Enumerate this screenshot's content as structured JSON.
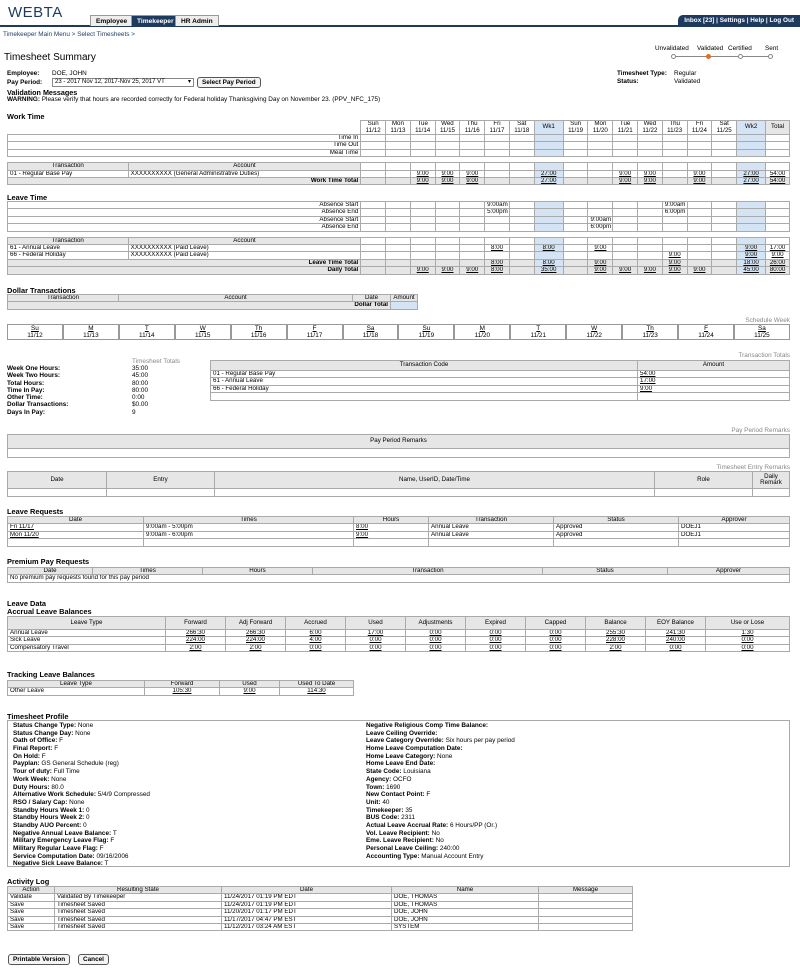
{
  "app": {
    "logo": "WEBTA",
    "tabs": [
      "Employee",
      "Timekeeper",
      "HR Admin"
    ],
    "active_tab": "Timekeeper",
    "inbox": "Inbox [23]",
    "settings": "Settings",
    "help": "Help",
    "logout": "Log Out",
    "sep": " | "
  },
  "breadcrumb": {
    "main": "Timekeeper Main Menu",
    "sep": " > ",
    "current": "Select Timesheets",
    "end": " >"
  },
  "page": {
    "title": "Timesheet Summary"
  },
  "progress": {
    "steps": [
      "Unvalidated",
      "Validated",
      "Certified",
      "Sent"
    ],
    "current": 1,
    "accent": "#e07020"
  },
  "header": {
    "employee_label": "Employee:",
    "employee": "DOE, JOHN",
    "period_label": "Pay Period:",
    "period": "23 - 2017  Nov 12, 2017-Nov 25, 2017 VT",
    "select_btn": "Select Pay Period",
    "type_label": "Timesheet Type:",
    "type": "Regular",
    "status_label": "Status:",
    "status": "Validated"
  },
  "validation": {
    "title": "Validation Messages",
    "warning_label": "WARNING:",
    "warning": " Please verify that hours are recorded correctly for Federal holiday Thanksgiving Day on November 23. (PPV_NFC_175)"
  },
  "days": [
    {
      "d": "Sun",
      "n": "11/12"
    },
    {
      "d": "Mon",
      "n": "11/13"
    },
    {
      "d": "Tue",
      "n": "11/14"
    },
    {
      "d": "Wed",
      "n": "11/15"
    },
    {
      "d": "Thu",
      "n": "11/16"
    },
    {
      "d": "Fri",
      "n": "11/17"
    },
    {
      "d": "Sat",
      "n": "11/18"
    },
    {
      "d": "Sun",
      "n": "11/19"
    },
    {
      "d": "Mon",
      "n": "11/20"
    },
    {
      "d": "Tue",
      "n": "11/21"
    },
    {
      "d": "Wed",
      "n": "11/22"
    },
    {
      "d": "Thu",
      "n": "11/23"
    },
    {
      "d": "Fri",
      "n": "11/24"
    },
    {
      "d": "Sat",
      "n": "11/25"
    }
  ],
  "wk1": "Wk1",
  "wk2": "Wk2",
  "total_label": "Total",
  "work_time": {
    "title": "Work Time",
    "rows": [
      "Time In",
      "Time Out",
      "Meal Time"
    ],
    "tx_header": "Transaction",
    "acct_header": "Account",
    "lines": [
      {
        "tx": "01 - Regular Base Pay",
        "acct": "XXXXXXXXXX (General Administrative Duties)",
        "v": [
          "",
          "",
          "9:00",
          "9:00",
          "9:00",
          "",
          "",
          "27:00",
          "",
          "",
          "9:00",
          "9:00",
          "",
          "9:00",
          "",
          "27:00",
          "54:00"
        ]
      }
    ],
    "total_label": "Work Time Total",
    "total": [
      "",
      "",
      "9:00",
      "9:00",
      "9:00",
      "",
      "",
      "27:00",
      "",
      "",
      "9:00",
      "9:00",
      "",
      "9:00",
      "",
      "27:00",
      "54:00"
    ]
  },
  "leave_time": {
    "title": "Leave Time",
    "rows": [
      "Absence Start",
      "Absence End",
      "Absence Start",
      "Absence End"
    ],
    "abs": [
      [
        "",
        "",
        "",
        "",
        "",
        "9:00am",
        "",
        "",
        "",
        "",
        "",
        "",
        "9:00am",
        "",
        "",
        "",
        ""
      ],
      [
        "",
        "",
        "",
        "",
        "",
        "5:00pm",
        "",
        "",
        "",
        "",
        "",
        "",
        "6:00pm",
        "",
        "",
        "",
        ""
      ],
      [
        "",
        "",
        "",
        "",
        "",
        "",
        "",
        "",
        "",
        "9:00am",
        "",
        "",
        "",
        "",
        "",
        "",
        ""
      ],
      [
        "",
        "",
        "",
        "",
        "",
        "",
        "",
        "",
        "",
        "6:00pm",
        "",
        "",
        "",
        "",
        "",
        "",
        ""
      ]
    ],
    "lines": [
      {
        "tx": "61 - Annual Leave",
        "acct": "XXXXXXXXXX (Paid Leave)",
        "v": [
          "",
          "",
          "",
          "",
          "",
          "8:00",
          "",
          "8:00",
          "",
          "9:00",
          "",
          "",
          "",
          "",
          "",
          "9:00",
          "17:00"
        ]
      },
      {
        "tx": "66 - Federal Holiday",
        "acct": "XXXXXXXXXX (Paid Leave)",
        "v": [
          "",
          "",
          "",
          "",
          "",
          "",
          "",
          "",
          "",
          "",
          "",
          "",
          "9:00",
          "",
          "",
          "9:00",
          "9:00"
        ]
      }
    ],
    "total_label": "Leave Time Total",
    "total": [
      "",
      "",
      "",
      "",
      "",
      "8:00",
      "",
      "8:00",
      "",
      "9:00",
      "",
      "",
      "9:00",
      "",
      "",
      "18:00",
      "26:00"
    ],
    "daily_label": "Daily Total",
    "daily": [
      "",
      "",
      "9:00",
      "9:00",
      "9:00",
      "8:00",
      "",
      "35:00",
      "",
      "9:00",
      "9:00",
      "9:00",
      "9:00",
      "9:00",
      "",
      "45:00",
      "80:00"
    ]
  },
  "dollar": {
    "title": "Dollar Transactions",
    "headers": [
      "Transaction",
      "Account",
      "Date",
      "Amount"
    ],
    "total_label": "Dollar Total"
  },
  "schedule": {
    "label": "Schedule Week",
    "days": [
      "Su",
      "M",
      "T",
      "W",
      "Th",
      "F",
      "Sa",
      "Su",
      "M",
      "T",
      "W",
      "Th",
      "F",
      "Sa"
    ]
  },
  "totals": {
    "label": "Timesheet Totals",
    "rows": [
      [
        "Week One Hours:",
        "35:00"
      ],
      [
        "Week Two Hours:",
        "45:00"
      ],
      [
        "Total Hours:",
        "80:00"
      ],
      [
        "Time In Pay:",
        "80:00"
      ],
      [
        "Other Time:",
        "0:00"
      ],
      [
        "Dollar Transactions:",
        "$0.00"
      ],
      [
        "Days In Pay:",
        "9"
      ]
    ]
  },
  "tx_totals": {
    "label": "Transaction Totals",
    "headers": [
      "Transaction Code",
      "Amount"
    ],
    "rows": [
      [
        "01 - Regular Base Pay",
        "54:00"
      ],
      [
        "61 - Annual Leave",
        "17:00"
      ],
      [
        "66 - Federal Holiday",
        "9:00"
      ]
    ]
  },
  "remarks": {
    "label": "Pay Period Remarks",
    "header": "Pay Period Remarks"
  },
  "entry_remarks": {
    "label": "Timesheet Entry Remarks",
    "headers": [
      "Date",
      "Entry",
      "Name, UserID, Date/Time",
      "Role",
      "Daily Remark"
    ]
  },
  "leave_requests": {
    "title": "Leave Requests",
    "headers": [
      "Date",
      "Times",
      "Hours",
      "Transaction",
      "Status",
      "Approver"
    ],
    "rows": [
      [
        "Fri 11/17",
        "9:00am - 5:00pm",
        "8:00",
        "Annual Leave",
        "Approved",
        "DOEJ1"
      ],
      [
        "Mon 11/20",
        "9:00am - 6:00pm",
        "9:00",
        "Annual Leave",
        "Approved",
        "DOEJ1"
      ]
    ]
  },
  "premium": {
    "title": "Premium Pay Requests",
    "headers": [
      "Date",
      "Times",
      "Hours",
      "Transaction",
      "Status",
      "Approver"
    ],
    "empty": "No premium pay requests found for this pay period"
  },
  "leave_data": {
    "title": "Leave Data",
    "accrual_title": "Accrual Leave Balances",
    "headers": [
      "Leave Type",
      "Forward",
      "Adj Forward",
      "Accrued",
      "Used",
      "Adjustments",
      "Expired",
      "Capped",
      "Balance",
      "EOY Balance",
      "Use or Lose"
    ],
    "rows": [
      [
        "Annual Leave",
        "266:30",
        "266:30",
        "6:00",
        "17:00",
        "0:00",
        "0:00",
        "0:00",
        "255:30",
        "241:30",
        "1:30"
      ],
      [
        "Sick Leave",
        "224:00",
        "224:00",
        "4:00",
        "0:00",
        "0:00",
        "0:00",
        "0:00",
        "228:00",
        "240:00",
        "0:00"
      ],
      [
        "Compensatory Travel",
        "2:00",
        "2:00",
        "0:00",
        "0:00",
        "0:00",
        "0:00",
        "0:00",
        "2:00",
        "0:00",
        "0:00"
      ]
    ]
  },
  "tracking": {
    "title": "Tracking Leave Balances",
    "headers": [
      "Leave Type",
      "Forward",
      "Used",
      "Used To Date"
    ],
    "rows": [
      [
        "Other Leave",
        "105:30",
        "9:00",
        "114:30"
      ]
    ]
  },
  "profile": {
    "title": "Timesheet Profile",
    "left": [
      [
        "Status Change Type:",
        "None"
      ],
      [
        "Status Change Day:",
        "None"
      ],
      [
        "Oath of Office:",
        "F"
      ],
      [
        "Final Report:",
        "F"
      ],
      [
        "On Hold:",
        "F"
      ],
      [
        "Payplan:",
        "GS General Schedule (reg)"
      ],
      [
        "Tour of duty:",
        "Full Time"
      ],
      [
        "Work Week:",
        "None"
      ],
      [
        "Duty Hours:",
        "80.0"
      ],
      [
        "Alternative Work Schedule:",
        "5/4/9 Compressed"
      ],
      [
        "RSO / Salary Cap:",
        "None"
      ],
      [
        "Standby Hours Week 1:",
        "0"
      ],
      [
        "Standby Hours Week 2:",
        "0"
      ],
      [
        "Standby AUO Percent:",
        "0"
      ],
      [
        "Negative Annual Leave Balance:",
        "T"
      ],
      [
        "Military Emergency Leave Flag:",
        "F"
      ],
      [
        "Military Regular Leave Flag:",
        "F"
      ],
      [
        "Service Computation Date:",
        "09/16/2006"
      ],
      [
        "Negative Sick Leave Balance:",
        "T"
      ]
    ],
    "right": [
      [
        "Negative Religious Comp Time Balance:",
        ""
      ],
      [
        "Leave Ceiling Override:",
        ""
      ],
      [
        "Leave Category Override:",
        "Six hours per pay period"
      ],
      [
        "Home Leave Computation Date:",
        ""
      ],
      [
        "Home Leave Category:",
        "None"
      ],
      [
        "Home Leave End Date:",
        ""
      ],
      [
        "State Code:",
        "Louisiana"
      ],
      [
        "Agency:",
        "OCFO"
      ],
      [
        "Town:",
        "1690"
      ],
      [
        "New Contact Point:",
        "F"
      ],
      [
        "Unit:",
        "40"
      ],
      [
        "Timekeeper:",
        "35"
      ],
      [
        "BUS Code:",
        "2311"
      ],
      [
        "Actual Leave Accrual Rate:",
        "6 Hours/PP (Or.)"
      ],
      [
        "Vol. Leave Recipient:",
        "No"
      ],
      [
        "Eme. Leave Recipient:",
        "No"
      ],
      [
        "Personal Leave Ceiling:",
        "240:00"
      ],
      [
        "Accounting Type:",
        "Manual Account Entry"
      ]
    ]
  },
  "activity": {
    "title": "Activity Log",
    "headers": [
      "Action",
      "Resulting State",
      "Date",
      "Name",
      "Message"
    ],
    "rows": [
      [
        "Validate",
        "Validated By Timekeeper",
        "11/24/2017 01:19 PM EDT",
        "DOE, THOMAS",
        ""
      ],
      [
        "Save",
        "Timesheet Saved",
        "11/24/2017 01:19 PM EDT",
        "DOE, THOMAS",
        ""
      ],
      [
        "Save",
        "Timesheet Saved",
        "11/20/2017 01:17 PM EDT",
        "DOE, JOHN",
        ""
      ],
      [
        "Save",
        "Timesheet Saved",
        "11/17/2017 04:47 PM EST",
        "DOE, JOHN",
        ""
      ],
      [
        "Save",
        "Timesheet Saved",
        "11/12/2017 03:24 AM EST",
        "SYSTEM",
        ""
      ]
    ]
  },
  "buttons": {
    "print": "Printable Version",
    "cancel": "Cancel"
  }
}
